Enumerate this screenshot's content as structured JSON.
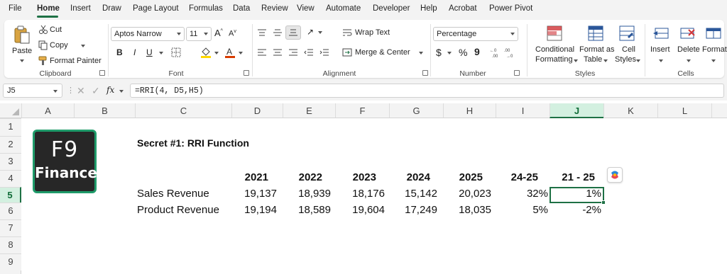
{
  "menu": {
    "tabs": [
      "File",
      "Home",
      "Insert",
      "Draw",
      "Page Layout",
      "Formulas",
      "Data",
      "Review",
      "View",
      "Automate",
      "Developer",
      "Help",
      "Acrobat",
      "Power Pivot"
    ],
    "active": "Home"
  },
  "ribbon": {
    "clipboard": {
      "paste": "Paste",
      "cut": "Cut",
      "copy": "Copy",
      "format_painter": "Format Painter",
      "group": "Clipboard"
    },
    "font": {
      "name": "Aptos Narrow",
      "size": "11",
      "bold": "B",
      "italic": "I",
      "underline": "U",
      "group": "Font"
    },
    "alignment": {
      "wrap_text": "Wrap Text",
      "merge_center": "Merge & Center",
      "group": "Alignment"
    },
    "number": {
      "format": "Percentage",
      "currency": "$",
      "percent": "%",
      "comma": "9",
      "group": "Number"
    },
    "styles": {
      "conditional_formatting": [
        "Conditional",
        "Formatting"
      ],
      "format_as_table": [
        "Format as",
        "Table"
      ],
      "cell_styles": [
        "Cell",
        "Styles"
      ],
      "group": "Styles"
    },
    "cells": {
      "insert": "Insert",
      "delete": "Delete",
      "format": "Format",
      "group": "Cells"
    }
  },
  "formula_bar": {
    "name_box": "J5",
    "fx": "fx",
    "formula": "=RRI(4, D5,H5)"
  },
  "grid": {
    "columns": [
      "A",
      "B",
      "C",
      "D",
      "E",
      "F",
      "G",
      "H",
      "I",
      "J",
      "K",
      "L"
    ],
    "rows": [
      "1",
      "2",
      "3",
      "4",
      "5",
      "6",
      "7",
      "8",
      "9"
    ],
    "selected_column": "J",
    "selected_row": "5"
  },
  "sheet": {
    "logo_top": "F9",
    "logo_bottom": "Finance",
    "title": "Secret #1: RRI Function",
    "headers": [
      "2021",
      "2022",
      "2023",
      "2024",
      "2025",
      "24-25",
      "21 - 25"
    ],
    "rows": [
      {
        "label": "Sales Revenue",
        "values": [
          "19,137",
          "18,939",
          "18,176",
          "15,142",
          "20,023",
          "32%",
          "1%"
        ]
      },
      {
        "label": "Product Revenue",
        "values": [
          "19,194",
          "18,589",
          "19,604",
          "17,249",
          "18,035",
          "5%",
          "-2%"
        ]
      }
    ]
  },
  "colors": {
    "accent": "#1e7145",
    "logo_border": "#1f9b6a",
    "logo_bg": "#272727"
  }
}
